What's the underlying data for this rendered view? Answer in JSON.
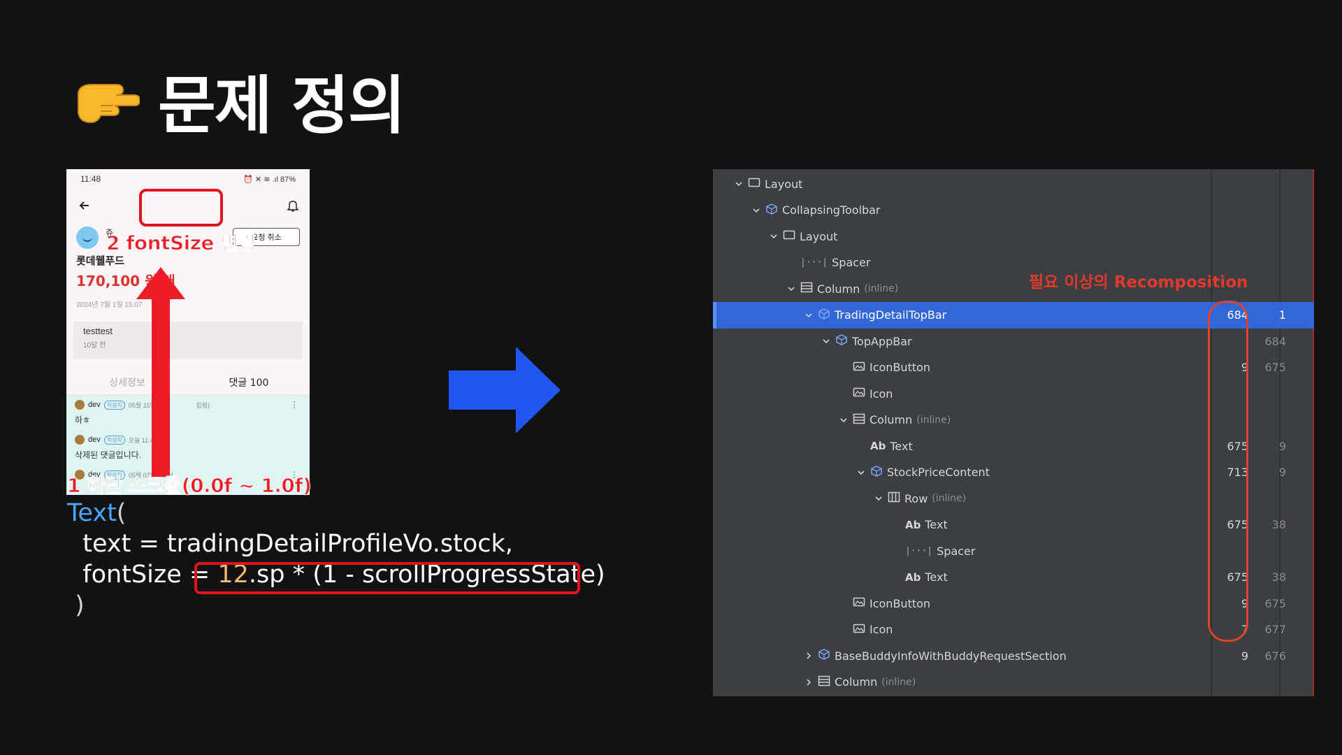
{
  "title": "문제 정의",
  "phone": {
    "status_time": "11:48",
    "status_icons": "⏰ ✕ ≋ .ıl 87%",
    "name": "쥬",
    "request_button": "요청 취소",
    "stock_name": "롯데웰푸드",
    "price": "170,100 원 매",
    "date": "2024년 7월 1일 15:07",
    "post_text": "testtest",
    "post_time": "10달 전",
    "tab_detail": "상세정보",
    "tab_comments": "댓글 100",
    "comments": [
      {
        "user": "dev",
        "badge": "작성자",
        "meta": "05월 15일 17",
        "suffix": "집됨)",
        "body": "하ㅎ"
      },
      {
        "user": "dev",
        "badge": "작성자",
        "meta": "오늘 11:48",
        "suffix": "",
        "body": "삭제된 댓글입니다."
      },
      {
        "user": "dev",
        "badge": "작성자",
        "meta": "05월 07일 18:24",
        "suffix": "",
        "body": ""
      }
    ]
  },
  "annotations": {
    "fontsize_change": "2 fontSize 변경",
    "scroll": "1 하단 스크롤(0.0f ~ 1.0f)",
    "recomposition": "필요 이상의 Recomposition"
  },
  "code": {
    "line1_fn": "Text",
    "line1_paren": "(",
    "line2": "  text = tradingDetailProfileVo.stock,",
    "line3_prefix": "  fontSize = ",
    "line3_num": "12",
    "line3_rest": ".sp * (1 - scrollProgressState)",
    "line4": " )"
  },
  "inspector": {
    "rows": [
      {
        "label": "Layout",
        "inline": "",
        "count": "",
        "skip": ""
      },
      {
        "label": "CollapsingToolbar",
        "inline": "",
        "count": "",
        "skip": ""
      },
      {
        "label": "Layout",
        "inline": "",
        "count": "",
        "skip": ""
      },
      {
        "label": "Spacer",
        "inline": "",
        "count": "",
        "skip": ""
      },
      {
        "label": "Column",
        "inline": "(inline)",
        "count": "",
        "skip": ""
      },
      {
        "label": "TradingDetailTopBar",
        "inline": "",
        "count": "684",
        "skip": "1"
      },
      {
        "label": "TopAppBar",
        "inline": "",
        "count": "",
        "skip": "684"
      },
      {
        "label": "IconButton",
        "inline": "",
        "count": "9",
        "skip": "675"
      },
      {
        "label": "Icon",
        "inline": "",
        "count": "",
        "skip": ""
      },
      {
        "label": "Column",
        "inline": "(inline)",
        "count": "",
        "skip": ""
      },
      {
        "label": "Text",
        "inline": "",
        "count": "675",
        "skip": "9"
      },
      {
        "label": "StockPriceContent",
        "inline": "",
        "count": "713",
        "skip": "9"
      },
      {
        "label": "Row",
        "inline": "(inline)",
        "count": "",
        "skip": ""
      },
      {
        "label": "Text",
        "inline": "",
        "count": "675",
        "skip": "38"
      },
      {
        "label": "Spacer",
        "inline": "",
        "count": "",
        "skip": ""
      },
      {
        "label": "Text",
        "inline": "",
        "count": "675",
        "skip": "38"
      },
      {
        "label": "IconButton",
        "inline": "",
        "count": "9",
        "skip": "675"
      },
      {
        "label": "Icon",
        "inline": "",
        "count": "7",
        "skip": "677"
      },
      {
        "label": "BaseBuddyInfoWithBuddyRequestSection",
        "inline": "",
        "count": "9",
        "skip": "676"
      },
      {
        "label": "Column",
        "inline": "(inline)",
        "count": "",
        "skip": ""
      }
    ]
  },
  "colors": {
    "annotation_red": "#ee1c25",
    "selection_blue": "#3366d6",
    "arrow_blue": "#1f57f0"
  }
}
